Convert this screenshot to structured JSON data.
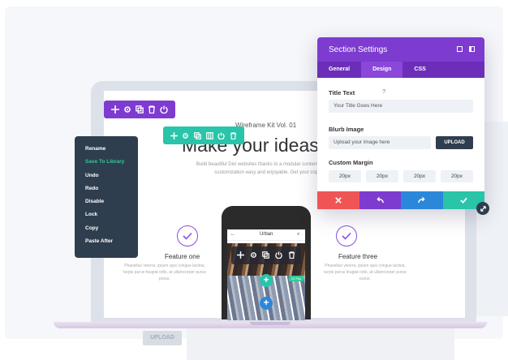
{
  "colors": {
    "purple": "#7e3bd0",
    "teal": "#29c4a9",
    "dark": "#2f3e4e",
    "red": "#ef5555",
    "blue": "#2b87da",
    "green": "#2ecc9a"
  },
  "page": {
    "kit_label": "Wireframe Kit Vol. 01",
    "headline": "Make your ideas a re",
    "subline": "Build beautiful Divi websites thanks to a modular content customization easy and enjoyable. Get your cop"
  },
  "features": [
    {
      "title": "Feature one",
      "text": "Phasellus viverra, ipsum quis congue lacinia, turpis purus feugiat odio, at ullamcorper purus purus."
    },
    {
      "title": "Feature three",
      "text": "Phasellus viverra, ipsum quis congue lacinia, turpis purus feugiat odio, at ullamcorper purus purus."
    }
  ],
  "phone": {
    "nav_title": "Urban",
    "tag": "10 Pas"
  },
  "context_menu": {
    "items": [
      "Rename",
      "Save To Library",
      "Undo",
      "Redo",
      "Disable",
      "Lock",
      "Copy",
      "Paste After"
    ],
    "highlighted_index": 1
  },
  "modal": {
    "title": "Section Settings",
    "tabs": [
      "General",
      "Design",
      "CSS"
    ],
    "active_tab": "Design",
    "title_text_label": "Title Text",
    "help_symbol": "?",
    "title_text_value": "Your Title Goes Here",
    "blurb_image_label": "Blurb Image",
    "blurb_image_value": "Upload your image here",
    "upload_label": "UPLOAD",
    "custom_margin_label": "Custom Margin",
    "margins": [
      "20px",
      "20px",
      "20px",
      "20px"
    ]
  },
  "background": {
    "ghost_upload_label": "UPLOAD"
  },
  "icons": {
    "toolbar": [
      "move-icon",
      "gear-icon",
      "duplicate-icon",
      "columns-icon",
      "power-icon",
      "trash-icon"
    ],
    "actions": [
      "close-icon",
      "undo-icon",
      "redo-icon",
      "check-icon"
    ]
  }
}
